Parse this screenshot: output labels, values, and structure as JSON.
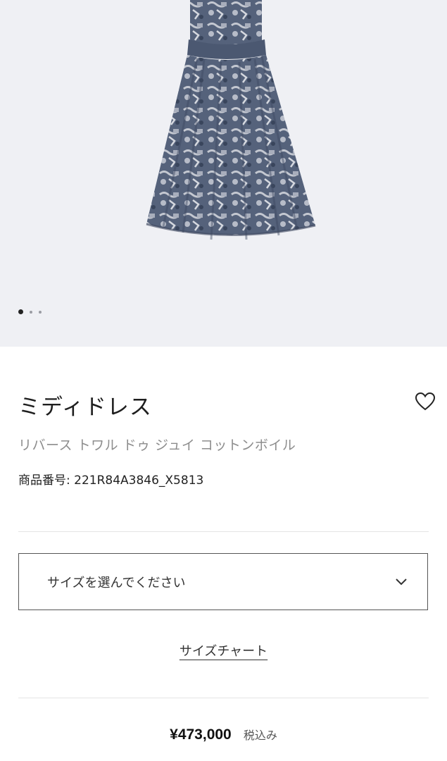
{
  "gallery": {
    "image_alt": "",
    "dots_total": 3,
    "dots_active_index": 0
  },
  "product": {
    "title": "ミディドレス",
    "subtitle": "リバース トワル ドゥ ジュイ コットンボイル",
    "reference": "商品番号: 221R84A3846_X5813"
  },
  "size_select": {
    "placeholder": "サイズを選んでください"
  },
  "size_chart": {
    "label": "サイズチャート"
  },
  "price": {
    "amount": "¥473,000",
    "tax_note": "税込み"
  },
  "icons": {
    "favorite": "heart-outline-icon",
    "dropdown": "chevron-down-icon"
  },
  "colors": {
    "gallery_background": "#eff0f4",
    "dress_navy": "#4b5871",
    "dress_light": "#c9ccd4"
  }
}
